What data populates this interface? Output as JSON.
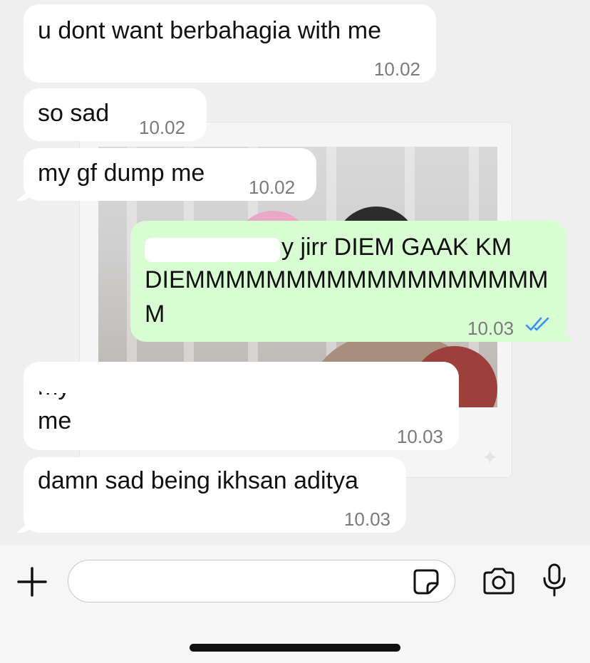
{
  "messages": [
    {
      "direction": "incoming",
      "text": "u dont want berbahagia with me",
      "time": "10.02"
    },
    {
      "direction": "incoming",
      "text": "so sad",
      "time": "10.02"
    },
    {
      "direction": "incoming",
      "text": "my gf dump me",
      "time": "10.02"
    },
    {
      "direction": "outgoing",
      "line1": "y jirr DIEM GAAK KM",
      "line2": "DIEMMMMMMMMMMMMMMMMMM",
      "line3": "M",
      "time": "10.03",
      "status": "read"
    },
    {
      "direction": "incoming",
      "line1": "my",
      "line2": "me",
      "time": "10.03"
    },
    {
      "direction": "incoming",
      "text": "damn sad being ikhsan aditya",
      "time": "10.03"
    }
  ],
  "composer": {
    "placeholder": "",
    "value": ""
  },
  "icons": {
    "plus": "plus-icon",
    "sticker": "sticker-icon",
    "camera": "camera-icon",
    "microphone": "microphone-icon",
    "read_receipt": "double-check-icon"
  },
  "colors": {
    "outgoing_bubble": "#d9fdd3",
    "incoming_bubble": "#ffffff",
    "read_tick": "#3b8ff6",
    "chat_background": "#efefef"
  }
}
